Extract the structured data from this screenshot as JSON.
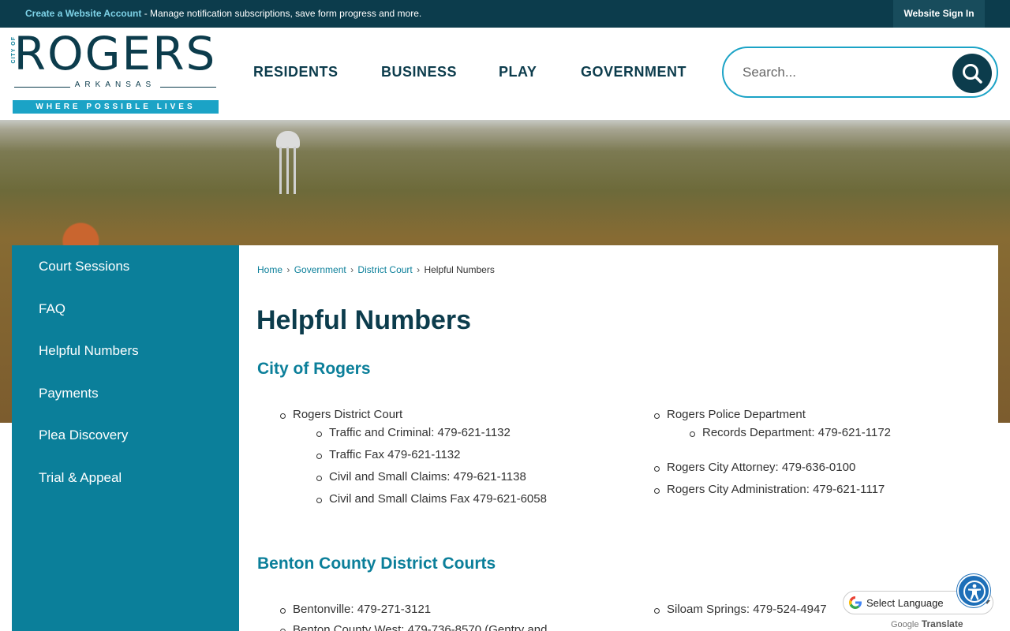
{
  "topbar": {
    "account_link": "Create a Website Account",
    "message": " - Manage notification subscriptions, save form progress and more.",
    "sign_in": "Website Sign In"
  },
  "logo": {
    "city_of": "CITY OF",
    "name": "ROGERS",
    "state": "ARKANSAS",
    "tagline": "WHERE POSSIBLE LIVES"
  },
  "nav": {
    "items": [
      "RESIDENTS",
      "BUSINESS",
      "PLAY",
      "GOVERNMENT"
    ]
  },
  "search": {
    "placeholder": "Search..."
  },
  "sidebar": {
    "items": [
      "Court Sessions",
      "FAQ",
      "Helpful Numbers",
      "Payments",
      "Plea Discovery",
      "Trial & Appeal"
    ]
  },
  "breadcrumb": {
    "items": [
      "Home",
      "Government",
      "District Court"
    ],
    "current": "Helpful Numbers",
    "separator": "›"
  },
  "page": {
    "title": "Helpful Numbers",
    "section1": {
      "heading": "City of Rogers",
      "col1_parent": "Rogers District Court",
      "col1_children": [
        "Traffic and Criminal: 479-621-1132",
        "Traffic Fax 479-621-1132",
        "Civil and Small Claims: 479-621-1138",
        "Civil and Small Claims Fax 479-621-6058"
      ],
      "col2_parent": "Rogers Police Department",
      "col2_child": "Records Department: 479-621-1172",
      "col2_items": [
        "Rogers City Attorney: 479-636-0100",
        "Rogers City Administration: 479-621-1117"
      ]
    },
    "section2": {
      "heading": "Benton County District Courts",
      "col1_items": [
        "Bentonville: 479-271-3121",
        "Benton County West: 479-736-8570 (Gentry and"
      ],
      "col2_items": [
        "Siloam Springs: 479-524-4947"
      ]
    }
  },
  "translate": {
    "select_label": "Select Language",
    "powered_google": "Google",
    "powered_translate": "Translate"
  },
  "colors": {
    "navy": "#0c3c4c",
    "teal": "#0b7f9a",
    "cyan": "#1ba3c6"
  }
}
